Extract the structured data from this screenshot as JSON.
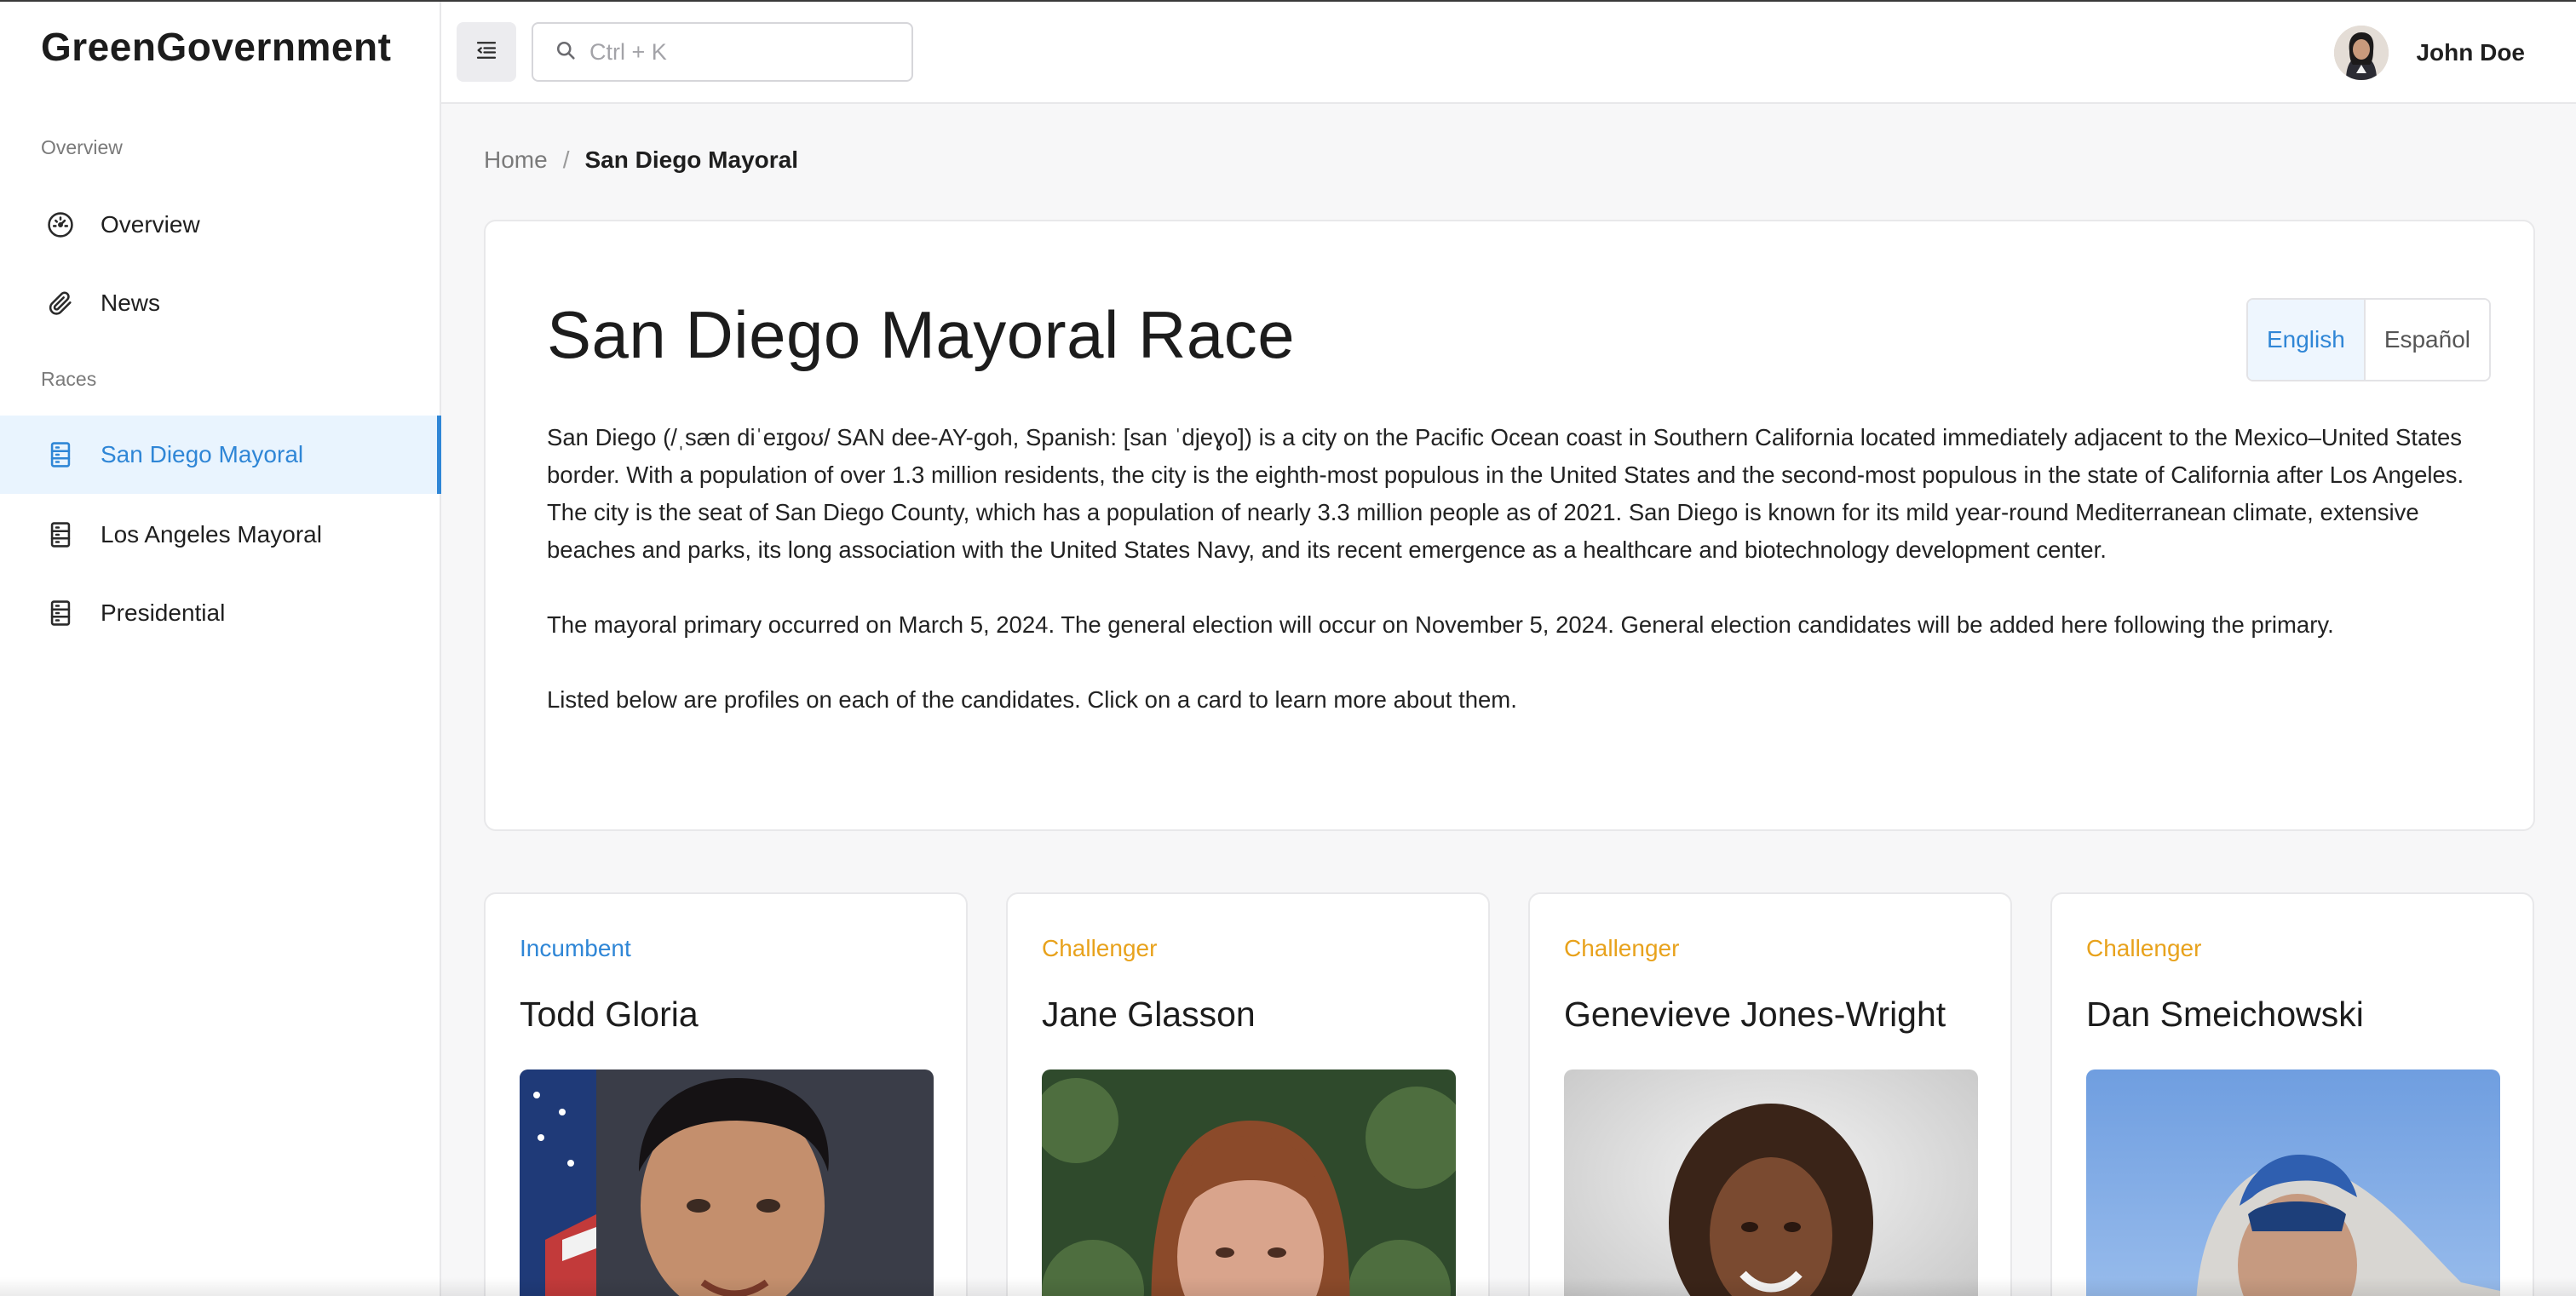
{
  "app": {
    "brand": "GreenGovernment"
  },
  "sidebar": {
    "sections": [
      {
        "label": "Overview"
      },
      {
        "label": "Races"
      }
    ],
    "items": [
      {
        "label": "Overview",
        "icon": "dashboard-gauge-icon"
      },
      {
        "label": "News",
        "icon": "paperclip-icon"
      },
      {
        "label": "San Diego Mayoral",
        "icon": "ballot-list-icon",
        "active": true
      },
      {
        "label": "Los Angeles Mayoral",
        "icon": "ballot-list-icon"
      },
      {
        "label": "Presidential",
        "icon": "ballot-list-icon"
      }
    ]
  },
  "header": {
    "menu_icon": "collapse-menu-icon",
    "search": {
      "placeholder": "Ctrl + K",
      "value": "",
      "icon": "search-icon"
    },
    "user": {
      "name": "John Doe"
    }
  },
  "breadcrumb": {
    "home": "Home",
    "separator": "/",
    "current": "San Diego Mayoral"
  },
  "intro": {
    "title": "San Diego Mayoral Race",
    "languages": [
      {
        "label": "English",
        "active": true
      },
      {
        "label": "Español",
        "active": false
      }
    ],
    "paragraphs": [
      "San Diego (/ˌsæn diˈeɪɡoʊ/ SAN dee-AY-goh, Spanish: [san ˈdjeɣo]) is a city on the Pacific Ocean coast in Southern California located immediately adjacent to the Mexico–United States border. With a population of over 1.3 million residents, the city is the eighth-most populous in the United States and the second-most populous in the state of California after Los Angeles. The city is the seat of San Diego County, which has a population of nearly 3.3 million people as of 2021. San Diego is known for its mild year-round Mediterranean climate, extensive beaches and parks, its long association with the United States Navy, and its recent emergence as a healthcare and biotechnology development center.",
      "The mayoral primary occurred on March 5, 2024. The general election will occur on November 5, 2024. General election candidates will be added here following the primary.",
      "Listed below are profiles on each of the candidates. Click on a card to learn more about them."
    ]
  },
  "candidates": [
    {
      "status": "Incumbent",
      "name": "Todd Gloria"
    },
    {
      "status": "Challenger",
      "name": "Jane Glasson"
    },
    {
      "status": "Challenger",
      "name": "Genevieve Jones-Wright"
    },
    {
      "status": "Challenger",
      "name": "Dan Smeichowski"
    }
  ],
  "colors": {
    "accent": "#2f86d6",
    "challenger": "#e8a21c",
    "active_bg": "#e9f4fe"
  }
}
